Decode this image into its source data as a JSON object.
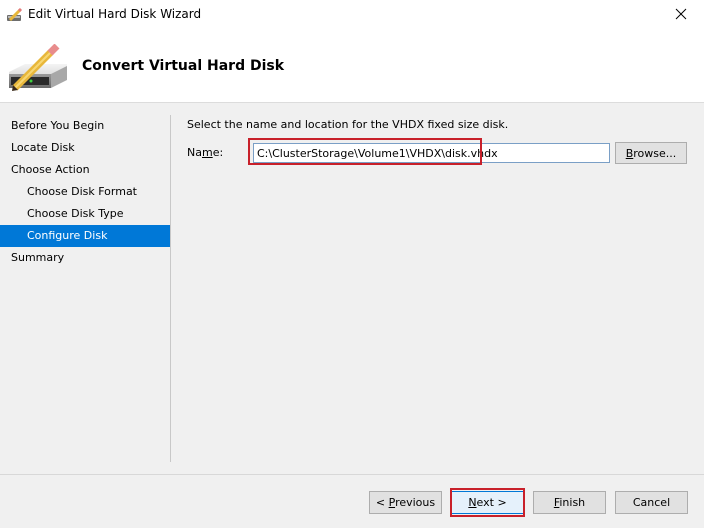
{
  "window": {
    "title": "Edit Virtual Hard Disk Wizard",
    "app_icon": "hard-disk-pencil-icon",
    "close_icon": "close-icon"
  },
  "header": {
    "title": "Convert Virtual Hard Disk",
    "icon": "hard-disk-pencil-icon"
  },
  "nav": {
    "items": [
      {
        "label": "Before You Begin",
        "level": 0,
        "active": false
      },
      {
        "label": "Locate Disk",
        "level": 0,
        "active": false
      },
      {
        "label": "Choose Action",
        "level": 0,
        "active": false
      },
      {
        "label": "Choose Disk Format",
        "level": 1,
        "active": false
      },
      {
        "label": "Choose Disk Type",
        "level": 1,
        "active": false
      },
      {
        "label": "Configure Disk",
        "level": 1,
        "active": true
      },
      {
        "label": "Summary",
        "level": 0,
        "active": false
      }
    ]
  },
  "content": {
    "instruction": "Select the name and location for the VHDX fixed size disk.",
    "name_label_pre": "Na",
    "name_label_accel": "m",
    "name_label_post": "e:",
    "name_value": "C:\\ClusterStorage\\Volume1\\VHDX\\disk.vhdx",
    "browse_accel": "B",
    "browse_rest": "rowse..."
  },
  "footer": {
    "previous_pre": "< ",
    "previous_accel": "P",
    "previous_rest": "revious",
    "next_accel": "N",
    "next_rest": "ext >",
    "finish_accel": "F",
    "finish_rest": "inish",
    "cancel_label": "Cancel"
  },
  "annotations": {
    "highlight_color": "#c8202a",
    "highlighted": [
      "name-input",
      "next-button"
    ]
  },
  "colors": {
    "accent": "#0078d7",
    "selection_text": "#ffffff"
  }
}
